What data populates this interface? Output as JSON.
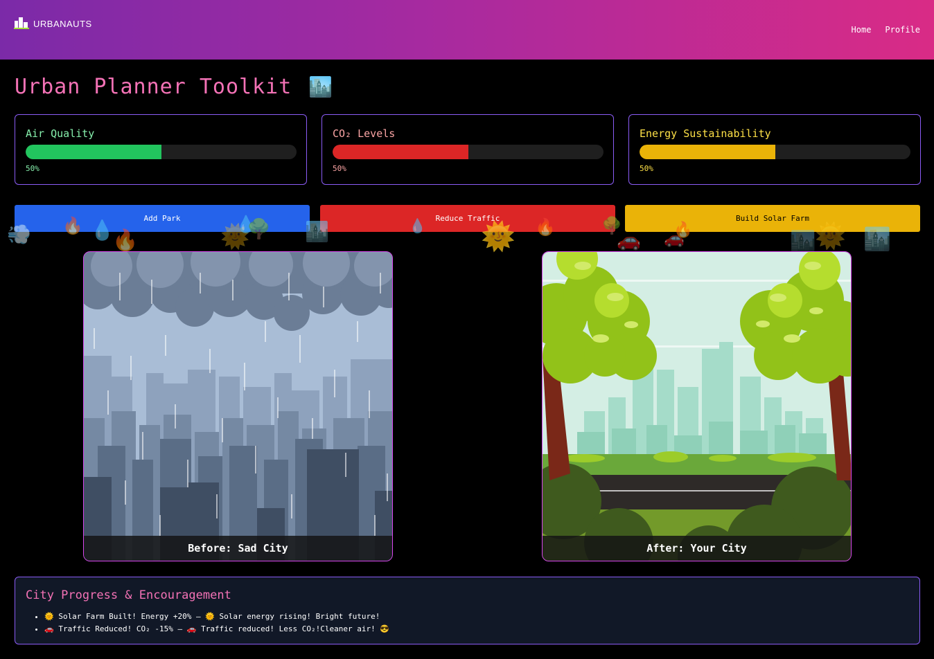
{
  "header": {
    "logo_text": "URBANAUTS",
    "nav": [
      "Home",
      "Profile"
    ]
  },
  "page": {
    "title": "Urban Planner Toolkit",
    "title_icon": "🏙️"
  },
  "meters": [
    {
      "label": "Air Quality",
      "percent_text": "50%",
      "value": 50,
      "color": "#22c55e",
      "label_color": "#86efac"
    },
    {
      "label": "CO₂ Levels",
      "percent_text": "50%",
      "value": 50,
      "color": "#dc2626",
      "label_color": "#fca5a5"
    },
    {
      "label": "Energy Sustainability",
      "percent_text": "50%",
      "value": 50,
      "color": "#eab308",
      "label_color": "#fde047"
    }
  ],
  "actions": [
    {
      "label": "Add Park",
      "color": "#2563eb",
      "text_color": "#ffffff"
    },
    {
      "label": "Reduce Traffic",
      "color": "#dc2626",
      "text_color": "#ffffff"
    },
    {
      "label": "Build Solar Farm",
      "color": "#eab308",
      "text_color": "#000000"
    }
  ],
  "panels": {
    "before_caption": "Before: Sad City",
    "after_caption": "After: Your City"
  },
  "progress": {
    "title": "City Progress & Encouragement",
    "items": [
      "🌞 Solar Farm Built! Energy +20% — 🌞 Solar energy rising! Bright future!",
      "🚗 Traffic Reduced! CO₂ -15% — 🚗 Traffic reduced! Less CO₂!Cleaner air! 😎"
    ]
  },
  "decor_icons": [
    "wind-icon",
    "fire-icon",
    "droplet-icon",
    "tree-icon",
    "sun-icon",
    "city-icon",
    "car-icon"
  ]
}
